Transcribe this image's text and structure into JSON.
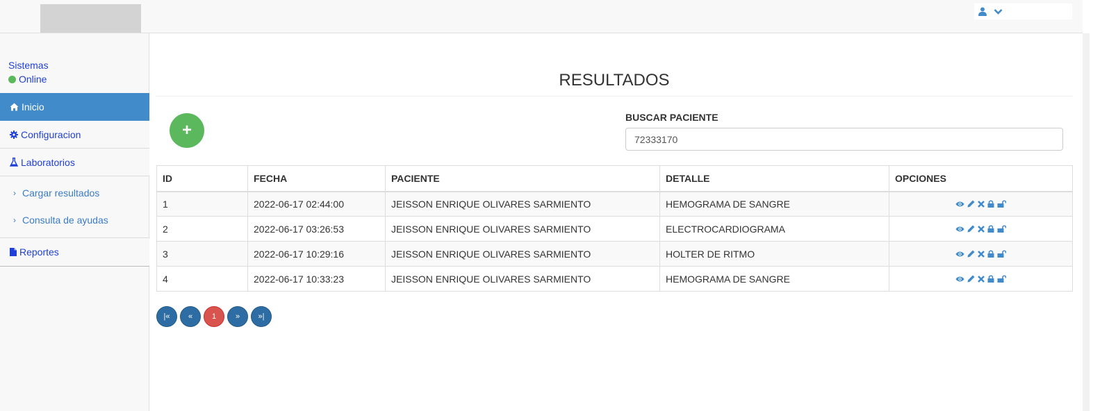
{
  "header": {
    "user_icon": "user-icon",
    "dropdown_icon": "chevron-down-icon"
  },
  "sidebar": {
    "system_label": "Sistemas",
    "status_label": "Online",
    "status_color": "#5cb85c",
    "items": [
      {
        "label": "Inicio",
        "icon": "home-icon",
        "active": true
      },
      {
        "label": "Configuracion",
        "icon": "gear-icon"
      },
      {
        "label": "Laboratorios",
        "icon": "flask-icon"
      },
      {
        "label": "Cargar resultados",
        "icon": "chevron-right-icon"
      },
      {
        "label": "Consulta de ayudas",
        "icon": "chevron-right-icon"
      },
      {
        "label": "Reportes",
        "icon": "file-icon"
      }
    ]
  },
  "main": {
    "title": "RESULTADOS",
    "add_button_label": "+",
    "search": {
      "label": "BUSCAR PACIENTE",
      "value": "72333170"
    },
    "table": {
      "columns": [
        "ID",
        "FECHA",
        "PACIENTE",
        "DETALLE",
        "OPCIONES"
      ],
      "rows": [
        {
          "id": "1",
          "fecha": "2022-06-17 02:44:00",
          "paciente": "JEISSON ENRIQUE OLIVARES SARMIENTO",
          "detalle": "HEMOGRAMA DE SANGRE"
        },
        {
          "id": "2",
          "fecha": "2022-06-17 03:26:53",
          "paciente": "JEISSON ENRIQUE OLIVARES SARMIENTO",
          "detalle": "ELECTROCARDIOGRAMA"
        },
        {
          "id": "3",
          "fecha": "2022-06-17 10:29:16",
          "paciente": "JEISSON ENRIQUE OLIVARES SARMIENTO",
          "detalle": "HOLTER DE RITMO"
        },
        {
          "id": "4",
          "fecha": "2022-06-17 10:33:23",
          "paciente": "JEISSON ENRIQUE OLIVARES SARMIENTO",
          "detalle": "HEMOGRAMA DE SANGRE"
        }
      ],
      "option_icons": [
        "eye-icon",
        "pencil-icon",
        "close-icon",
        "lock-icon",
        "unlock-icon"
      ]
    },
    "pagination": {
      "first": "|«",
      "prev": "«",
      "current": "1",
      "next": "»",
      "last": "»|"
    }
  }
}
